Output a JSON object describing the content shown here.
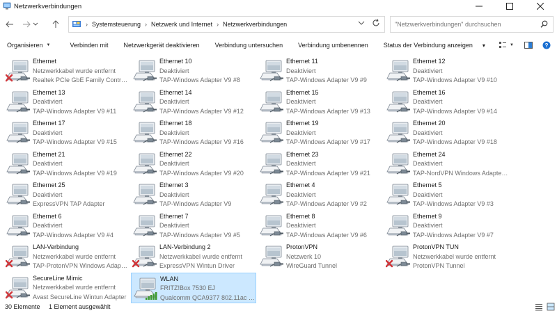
{
  "window": {
    "title": "Netzwerkverbindungen"
  },
  "address": {
    "segments": [
      "Systemsteuerung",
      "Netzwerk und Internet",
      "Netzwerkverbindungen"
    ],
    "separator": "›"
  },
  "search": {
    "placeholder": "\"Netzwerkverbindungen\" durchsuchen"
  },
  "toolbar": {
    "commands": [
      {
        "label": "Organisieren",
        "has_menu": true
      },
      {
        "label": "Verbinden mit",
        "has_menu": false
      },
      {
        "label": "Netzwerkgerät deaktivieren",
        "has_menu": false
      },
      {
        "label": "Verbindung untersuchen",
        "has_menu": false
      },
      {
        "label": "Verbindung umbenennen",
        "has_menu": false
      },
      {
        "label": "Status der Verbindung anzeigen",
        "has_menu": false
      }
    ],
    "more_glyph": "▾"
  },
  "items": [
    {
      "name": "Ethernet",
      "status": "Netzwerkkabel wurde entfernt",
      "adapter": "Realtek PCIe GbE Family Controller",
      "state": "unplugged"
    },
    {
      "name": "Ethernet 10",
      "status": "Deaktiviert",
      "adapter": "TAP-Windows Adapter V9 #8",
      "state": "disabled"
    },
    {
      "name": "Ethernet 11",
      "status": "Deaktiviert",
      "adapter": "TAP-Windows Adapter V9 #9",
      "state": "disabled"
    },
    {
      "name": "Ethernet 12",
      "status": "Deaktiviert",
      "adapter": "TAP-Windows Adapter V9 #10",
      "state": "disabled"
    },
    {
      "name": "Ethernet 13",
      "status": "Deaktiviert",
      "adapter": "TAP-Windows Adapter V9 #11",
      "state": "disabled"
    },
    {
      "name": "Ethernet 14",
      "status": "Deaktiviert",
      "adapter": "TAP-Windows Adapter V9 #12",
      "state": "disabled"
    },
    {
      "name": "Ethernet 15",
      "status": "Deaktiviert",
      "adapter": "TAP-Windows Adapter V9 #13",
      "state": "disabled"
    },
    {
      "name": "Ethernet 16",
      "status": "Deaktiviert",
      "adapter": "TAP-Windows Adapter V9 #14",
      "state": "disabled"
    },
    {
      "name": "Ethernet 17",
      "status": "Deaktiviert",
      "adapter": "TAP-Windows Adapter V9 #15",
      "state": "disabled"
    },
    {
      "name": "Ethernet 18",
      "status": "Deaktiviert",
      "adapter": "TAP-Windows Adapter V9 #16",
      "state": "disabled"
    },
    {
      "name": "Ethernet 19",
      "status": "Deaktiviert",
      "adapter": "TAP-Windows Adapter V9 #17",
      "state": "disabled"
    },
    {
      "name": "Ethernet 20",
      "status": "Deaktiviert",
      "adapter": "TAP-Windows Adapter V9 #18",
      "state": "disabled"
    },
    {
      "name": "Ethernet 21",
      "status": "Deaktiviert",
      "adapter": "TAP-Windows Adapter V9 #19",
      "state": "disabled"
    },
    {
      "name": "Ethernet 22",
      "status": "Deaktiviert",
      "adapter": "TAP-Windows Adapter V9 #20",
      "state": "disabled"
    },
    {
      "name": "Ethernet 23",
      "status": "Deaktiviert",
      "adapter": "TAP-Windows Adapter V9 #21",
      "state": "disabled"
    },
    {
      "name": "Ethernet 24",
      "status": "Deaktiviert",
      "adapter": "TAP-NordVPN Windows Adapter ...",
      "state": "disabled"
    },
    {
      "name": "Ethernet 25",
      "status": "Deaktiviert",
      "adapter": "ExpressVPN TAP Adapter",
      "state": "disabled"
    },
    {
      "name": "Ethernet 3",
      "status": "Deaktiviert",
      "adapter": "TAP-Windows Adapter V9",
      "state": "disabled"
    },
    {
      "name": "Ethernet 4",
      "status": "Deaktiviert",
      "adapter": "TAP-Windows Adapter V9 #2",
      "state": "disabled"
    },
    {
      "name": "Ethernet 5",
      "status": "Deaktiviert",
      "adapter": "TAP-Windows Adapter V9 #3",
      "state": "disabled"
    },
    {
      "name": "Ethernet 6",
      "status": "Deaktiviert",
      "adapter": "TAP-Windows Adapter V9 #4",
      "state": "disabled"
    },
    {
      "name": "Ethernet 7",
      "status": "Deaktiviert",
      "adapter": "TAP-Windows Adapter V9 #5",
      "state": "disabled"
    },
    {
      "name": "Ethernet 8",
      "status": "Deaktiviert",
      "adapter": "TAP-Windows Adapter V9 #6",
      "state": "disabled"
    },
    {
      "name": "Ethernet 9",
      "status": "Deaktiviert",
      "adapter": "TAP-Windows Adapter V9 #7",
      "state": "disabled"
    },
    {
      "name": "LAN-Verbindung",
      "status": "Netzwerkkabel wurde entfernt",
      "adapter": "TAP-ProtonVPN Windows Adapte...",
      "state": "unplugged"
    },
    {
      "name": "LAN-Verbindung 2",
      "status": "Netzwerkkabel wurde entfernt",
      "adapter": "ExpressVPN Wintun Driver",
      "state": "unplugged"
    },
    {
      "name": "ProtonVPN",
      "status": "Netzwerk 10",
      "adapter": "WireGuard Tunnel",
      "state": "connected"
    },
    {
      "name": "ProtonVPN TUN",
      "status": "Netzwerkkabel wurde entfernt",
      "adapter": "ProtonVPN Tunnel",
      "state": "unplugged"
    },
    {
      "name": "SecureLine Mimic",
      "status": "Netzwerkkabel wurde entfernt",
      "adapter": "Avast SecureLine Wintun Adapter",
      "state": "unplugged"
    },
    {
      "name": "WLAN",
      "status": "FRITZ!Box 7530 EJ",
      "adapter": "Qualcomm QCA9377 802.11ac W...",
      "state": "wifi",
      "selected": true
    }
  ],
  "statusbar": {
    "count": "30 Elemente",
    "selection": "1 Element ausgewählt"
  },
  "colors": {
    "selection_bg": "#cce8ff",
    "selection_border": "#99d1ff",
    "error_red": "#d13438",
    "wifi_green": "#3c9a2e",
    "secondary_text": "#6d6d6d"
  },
  "icons": {
    "app": "network-connections-icon",
    "back": "arrow-left-icon",
    "forward": "arrow-right-icon",
    "recent": "chevron-down-icon",
    "up": "arrow-up-icon",
    "refresh": "refresh-icon",
    "search": "search-icon"
  }
}
